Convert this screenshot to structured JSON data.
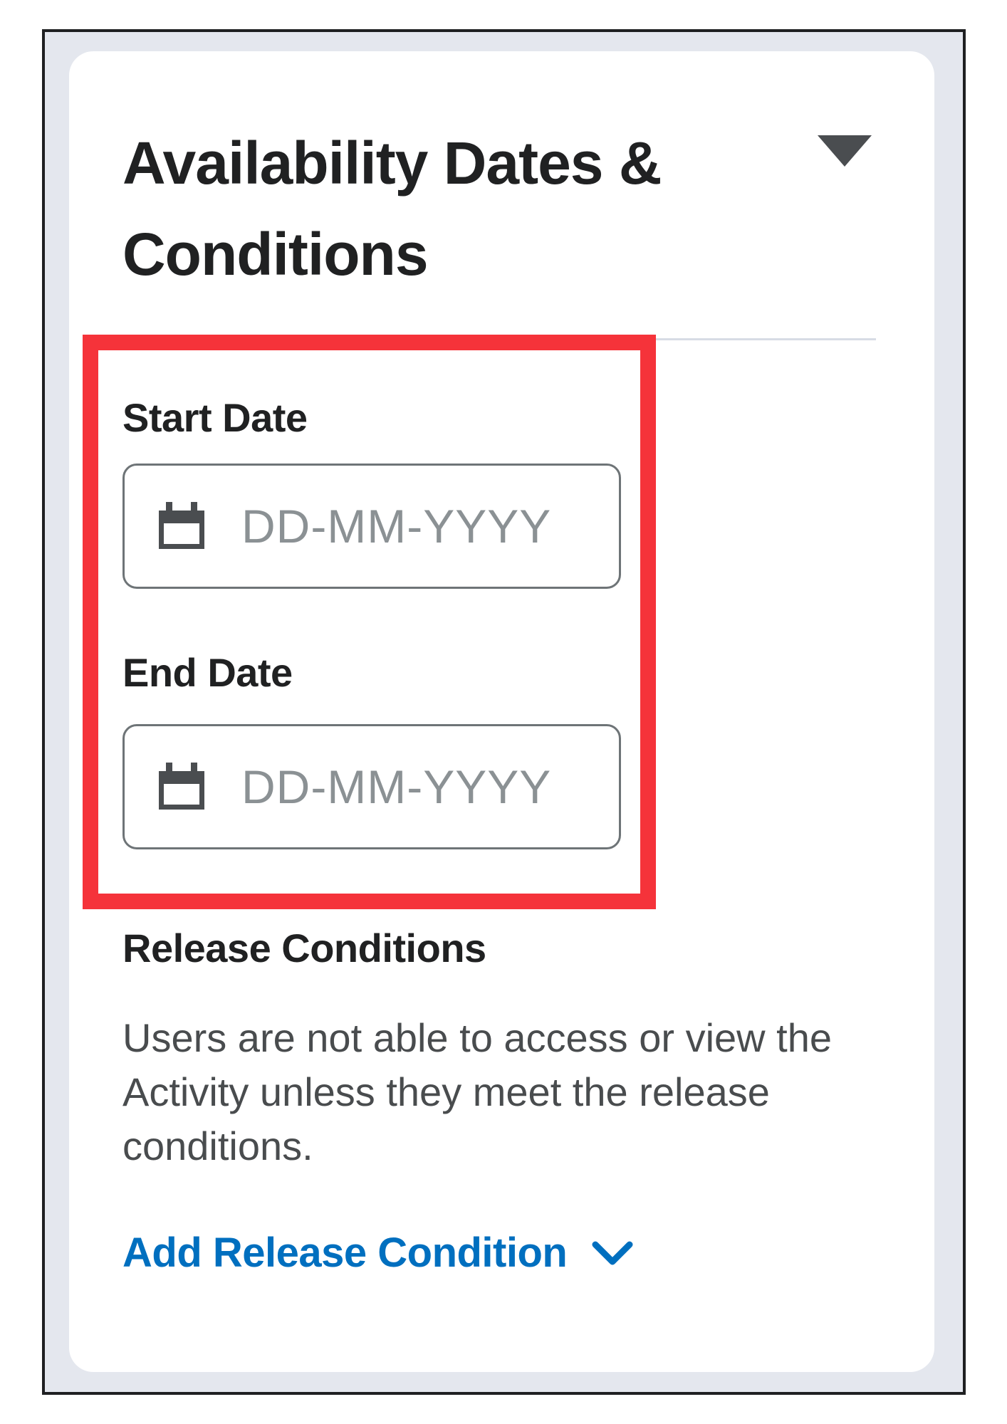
{
  "panel": {
    "title": "Availability Dates & Conditions",
    "collapse_icon": "triangle-down-icon"
  },
  "start_date": {
    "label": "Start Date",
    "placeholder": "DD-MM-YYYY",
    "value": "",
    "icon": "calendar-icon"
  },
  "end_date": {
    "label": "End Date",
    "placeholder": "DD-MM-YYYY",
    "value": "",
    "icon": "calendar-icon"
  },
  "release_conditions": {
    "heading": "Release Conditions",
    "description": "Users are not able to access or view the Activity unless they meet the release conditions.",
    "add_link_label": "Add Release Condition",
    "add_link_icon": "chevron-down-icon"
  },
  "colors": {
    "highlight": "#f5333a",
    "link": "#006fbf",
    "text_primary": "#202122",
    "text_secondary": "#494c4e",
    "placeholder": "#8b9194",
    "frame_background": "#e4e7ee"
  }
}
